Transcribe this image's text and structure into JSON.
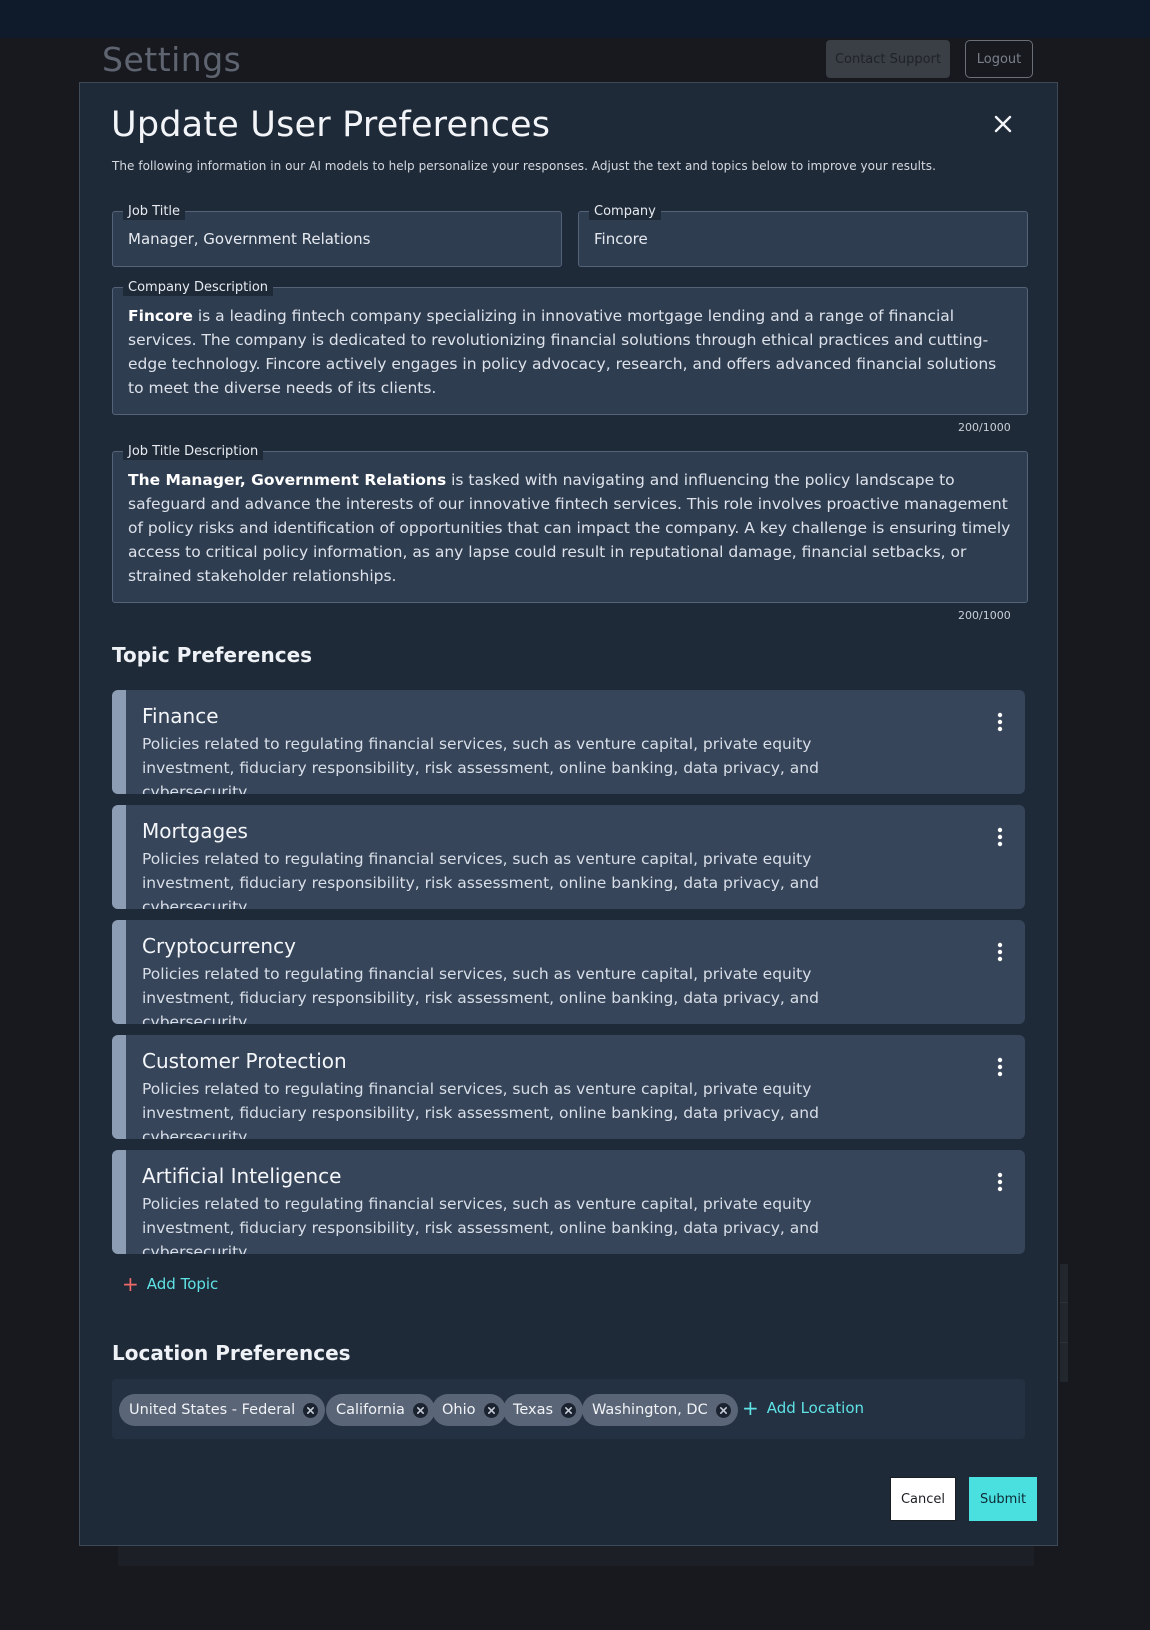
{
  "background": {
    "page_title": "Settings",
    "contact_support_label": "Contact Support",
    "logout_label": "Logout"
  },
  "modal": {
    "title": "Update User Preferences",
    "subtitle": "The following information in our AI models to help personalize your responses. Adjust the text and topics below to improve your results.",
    "close_icon": "close-icon",
    "job_title": {
      "label": "Job Title",
      "value": "Manager, Government Relations"
    },
    "company": {
      "label": "Company",
      "value": "Fincore"
    },
    "company_description": {
      "label": "Company Description",
      "bold": "Fincore",
      "text": " is a leading fintech company specializing in innovative mortgage lending and a range of financial services. The company is dedicated to revolutionizing financial solutions through ethical practices and cutting-edge technology. Fincore actively engages in policy advocacy, research, and offers advanced financial solutions to meet the diverse needs of its clients.",
      "counter": "200/1000"
    },
    "job_title_description": {
      "label": "Job Title Description",
      "bold": "The Manager, Government Relations",
      "text": " is tasked with navigating and influencing the policy landscape to safeguard and advance the interests of our innovative fintech services. This role involves proactive management of policy risks and identification of opportunities that can impact the company. A key challenge is ensuring timely access to critical policy information, as any lapse could result in reputational damage, financial setbacks, or strained stakeholder relationships.",
      "counter": "200/1000"
    },
    "topic_section_title": "Topic Preferences",
    "topics": [
      {
        "title": "Finance",
        "description": "Policies related to regulating financial services, such as venture capital, private equity investment, fiduciary responsibility, risk assessment, online banking, data privacy, and cybersecurity."
      },
      {
        "title": "Mortgages",
        "description": "Policies related to regulating financial services, such as venture capital, private equity investment, fiduciary responsibility, risk assessment, online banking, data privacy, and cybersecurity."
      },
      {
        "title": "Cryptocurrency",
        "description": "Policies related to regulating financial services, such as venture capital, private equity investment, fiduciary responsibility, risk assessment, online banking, data privacy, and cybersecurity."
      },
      {
        "title": "Customer Protection",
        "description": "Policies related to regulating financial services, such as venture capital, private equity investment, fiduciary responsibility, risk assessment, online banking, data privacy, and cybersecurity."
      },
      {
        "title": "Artificial Inteligence",
        "description": "Policies related to regulating financial services, such as venture capital, private equity investment, fiduciary responsibility, risk assessment, online banking, data privacy, and cybersecurity."
      }
    ],
    "add_topic_label": "Add Topic",
    "location_section_title": "Location Preferences",
    "locations": [
      "United States - Federal",
      "California",
      "Ohio",
      "Texas",
      "Washington, DC"
    ],
    "add_location_label": "Add Location",
    "cancel_label": "Cancel",
    "submit_label": "Submit"
  },
  "colors": {
    "accent": "#49e0df",
    "modal_bg": "#1f2a38",
    "card_bg": "#36455a"
  }
}
